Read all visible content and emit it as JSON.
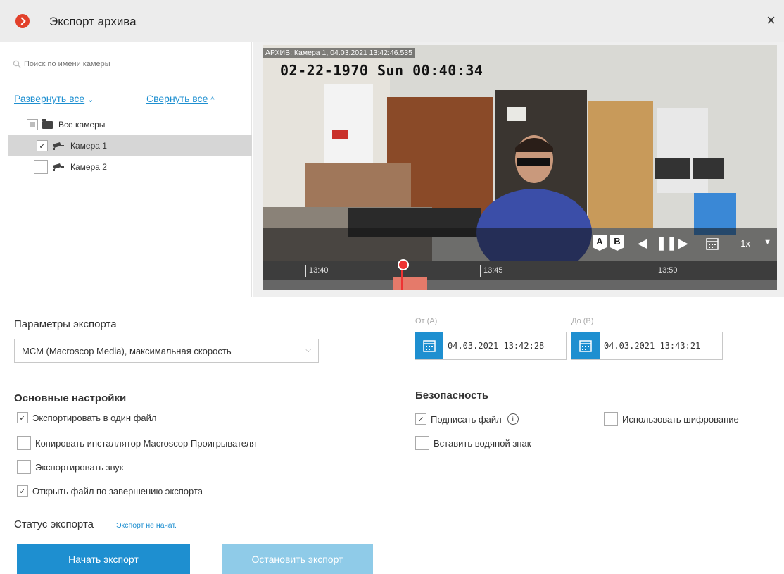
{
  "window": {
    "title": "Экспорт архива",
    "close": "×"
  },
  "search": {
    "placeholder": "Поиск по имени камеры"
  },
  "tree": {
    "expand_all": "Развернуть все",
    "collapse_all": "Свернуть все",
    "expand_caret": "⌄",
    "collapse_caret": "^",
    "root": {
      "label": "Все камеры",
      "state": "indeterminate"
    },
    "cameras": [
      {
        "label": "Камера 1",
        "checked": true,
        "selected": true
      },
      {
        "label": "Камера 2",
        "checked": false,
        "selected": false
      }
    ]
  },
  "video": {
    "osd_archive": "АРХИВ: Камера 1, 04.03.2021 13:42:46.535",
    "osd_camera_time": "02-22-1970 Sun 00:40:34",
    "marker_a": "A",
    "marker_b": "B",
    "speed": "1x",
    "timeline_ticks": [
      "13:40",
      "13:45",
      "13:50"
    ]
  },
  "export": {
    "params_label": "Параметры экспорта",
    "format_value": "МСМ (Macroscop Media), максимальная скорость",
    "from_label": "От (A)",
    "to_label": "До (B)",
    "from_value": "04.03.2021  13:42:28",
    "to_value": "04.03.2021  13:43:21"
  },
  "basic": {
    "title": "Основные настройки",
    "options": [
      {
        "label": "Экспортировать в один файл",
        "checked": true
      },
      {
        "label": "Копировать инсталлятор Macroscop Проигрывателя",
        "checked": false
      },
      {
        "label": "Экспортировать звук",
        "checked": false
      },
      {
        "label": "Открыть файл по завершению экспорта",
        "checked": true
      }
    ]
  },
  "security": {
    "title": "Безопасность",
    "sign": {
      "label": "Подписать файл",
      "checked": true
    },
    "watermark": {
      "label": "Вставить водяной знак",
      "checked": false
    },
    "encrypt": {
      "label": "Использовать шифрование",
      "checked": false
    },
    "info": "i"
  },
  "status": {
    "label": "Статус экспорта",
    "value": "Экспорт не начат."
  },
  "buttons": {
    "start": "Начать экспорт",
    "stop": "Остановить экспорт"
  },
  "colors": {
    "accent": "#1e8fd0",
    "accent_disabled": "#8fcbe8",
    "logo": "#e2402a",
    "range": "#e57a6a"
  }
}
